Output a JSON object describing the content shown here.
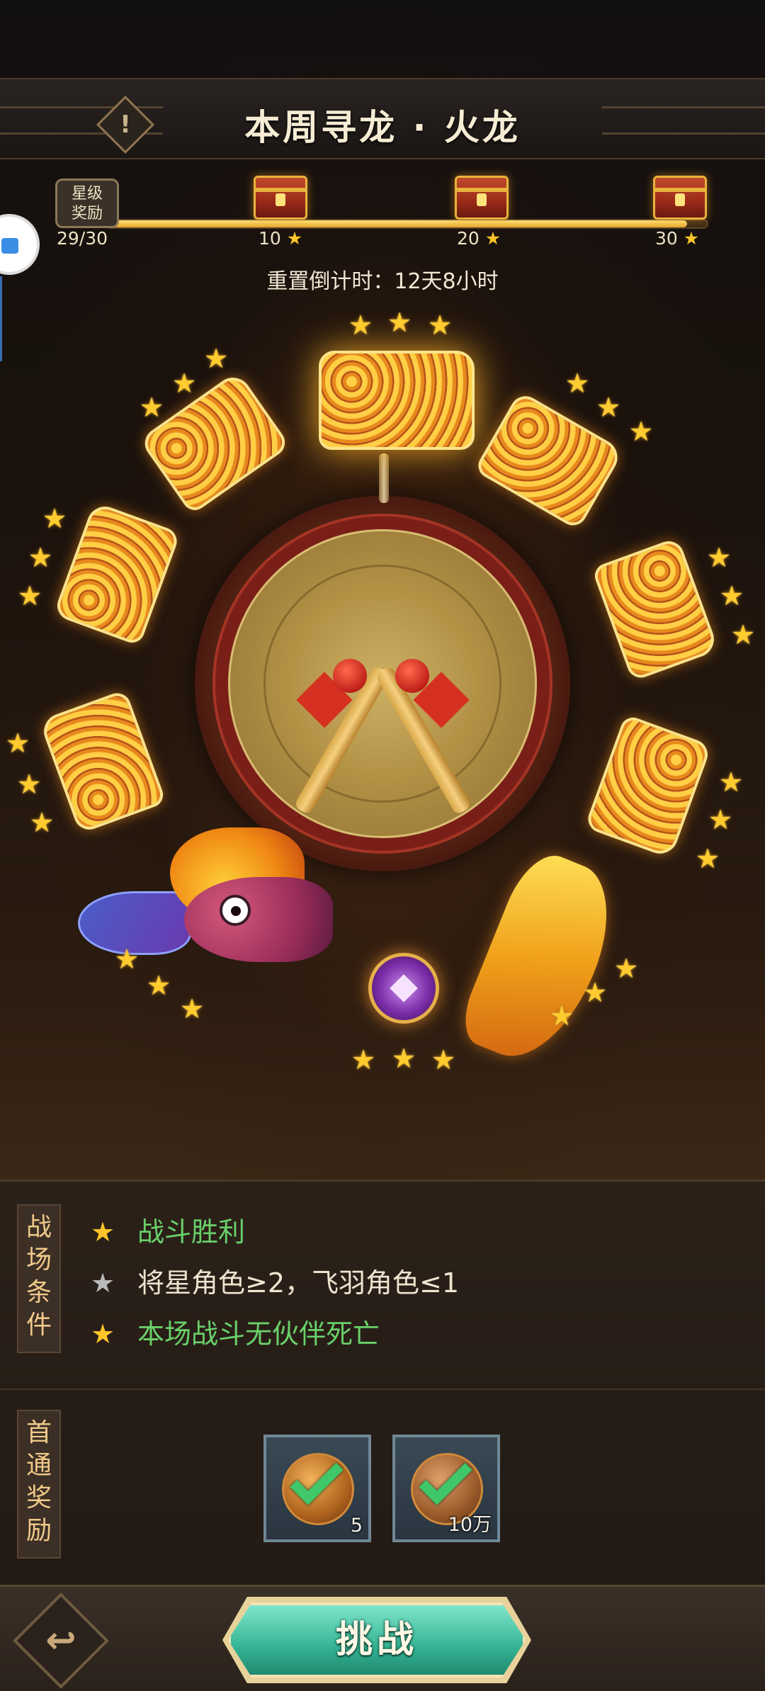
{
  "header": {
    "title": "本周寻龙 · 火龙",
    "info_icon": "info-icon",
    "info_glyph": "!"
  },
  "progress": {
    "badge_label_line1": "星级",
    "badge_label_line2": "奖励",
    "star_count": "29/30",
    "fill_fraction": 0.967,
    "milestones": [
      {
        "label": "10",
        "star": "★"
      },
      {
        "label": "20",
        "star": "★"
      },
      {
        "label": "30",
        "star": "★"
      }
    ],
    "countdown": "重置倒计时：12天8小时"
  },
  "conditions": {
    "tag": "战场条件",
    "items": [
      {
        "text": "战斗胜利",
        "star": "★",
        "met": true
      },
      {
        "text": "将星角色≥2，飞羽角色≤1",
        "star": "★",
        "met": false
      },
      {
        "text": "本场战斗无伙伴死亡",
        "star": "★",
        "met": true
      }
    ]
  },
  "first_clear": {
    "tag": "首通奖励",
    "rewards": [
      {
        "icon": "dragon-coin-icon",
        "quantity": "5",
        "claimed": true
      },
      {
        "icon": "copper-coin-icon",
        "quantity": "10万",
        "claimed": true
      }
    ]
  },
  "footer": {
    "back_icon": "back-arrow-icon",
    "back_glyph": "↩",
    "challenge_label": "挑战"
  },
  "colors": {
    "star_gold": "#ffc42a",
    "star_gray": "#b9b9b9",
    "met_green": "#6ad06a",
    "button_teal": "#35b394"
  }
}
